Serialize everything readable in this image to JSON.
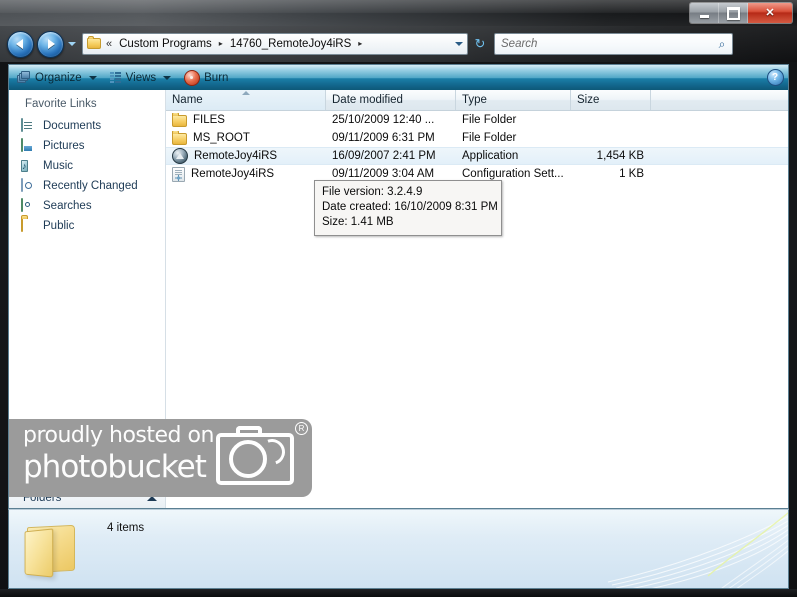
{
  "window": {
    "controls": {
      "minimize_label": "Minimize",
      "maximize_label": "Maximize",
      "close_label": "Close",
      "close_glyph": "✕"
    }
  },
  "address_bar": {
    "back_label": "Back",
    "forward_label": "Forward",
    "recent_pages_label": "Recent Pages",
    "double_chevron": "«",
    "crumbs": [
      {
        "label": "Custom Programs"
      },
      {
        "label": "14760_RemoteJoy4iRS"
      }
    ],
    "crumb_arrow": "▸",
    "refresh_glyph": "↻",
    "dropdown_label": "Previous Locations"
  },
  "search": {
    "placeholder": "Search",
    "icon": "search-icon",
    "glyph": "⌕"
  },
  "toolbar": {
    "organize_label": "Organize",
    "views_label": "Views",
    "burn_label": "Burn",
    "help_glyph": "?"
  },
  "navigation_pane": {
    "title": "Favorite Links",
    "items": [
      {
        "label": "Documents",
        "icon": "documents-icon"
      },
      {
        "label": "Pictures",
        "icon": "pictures-icon"
      },
      {
        "label": "Music",
        "icon": "music-icon",
        "glyph": "♪"
      },
      {
        "label": "Recently Changed",
        "icon": "recently-changed-icon"
      },
      {
        "label": "Searches",
        "icon": "searches-icon"
      },
      {
        "label": "Public",
        "icon": "public-folder-icon"
      }
    ],
    "folders_label": "Folders",
    "folders_chevron": "chevron-up-icon"
  },
  "file_list": {
    "columns": [
      {
        "label": "Name",
        "key": "name"
      },
      {
        "label": "Date modified",
        "key": "date"
      },
      {
        "label": "Type",
        "key": "type"
      },
      {
        "label": "Size",
        "key": "size"
      }
    ],
    "sorted_column": "Name",
    "rows": [
      {
        "name": "FILES",
        "date": "25/10/2009 12:40 ...",
        "type": "File Folder",
        "size": "",
        "icon": "folder-icon",
        "selected": false
      },
      {
        "name": "MS_ROOT",
        "date": "09/11/2009 6:31 PM",
        "type": "File Folder",
        "size": "",
        "icon": "folder-icon",
        "selected": false
      },
      {
        "name": "RemoteJoy4iRS",
        "date": "16/09/2007 2:41 PM",
        "type": "Application",
        "size": "1,454 KB",
        "icon": "application-icon",
        "selected": true
      },
      {
        "name": "RemoteJoy4iRS",
        "date": "09/11/2009 3:04 AM",
        "type": "Configuration Sett...",
        "size": "1 KB",
        "icon": "configuration-settings-icon",
        "selected": false
      }
    ]
  },
  "tooltip": {
    "lines": [
      "File version: 3.2.4.9",
      "Date created: 16/10/2009 8:31 PM",
      "Size: 1.41 MB"
    ]
  },
  "watermark": {
    "line1": "proudly hosted on",
    "line2": "photobucket",
    "registered_mark": "R"
  },
  "status_bar": {
    "item_count": "4 items",
    "folder_icon": "folder-icon"
  },
  "colors": {
    "accent": "#1b7fa8",
    "selection": "#e3f0f9",
    "link_text": "#1d3a55",
    "folder_yellow": "#f7d169",
    "close_button": "#d9503a"
  }
}
